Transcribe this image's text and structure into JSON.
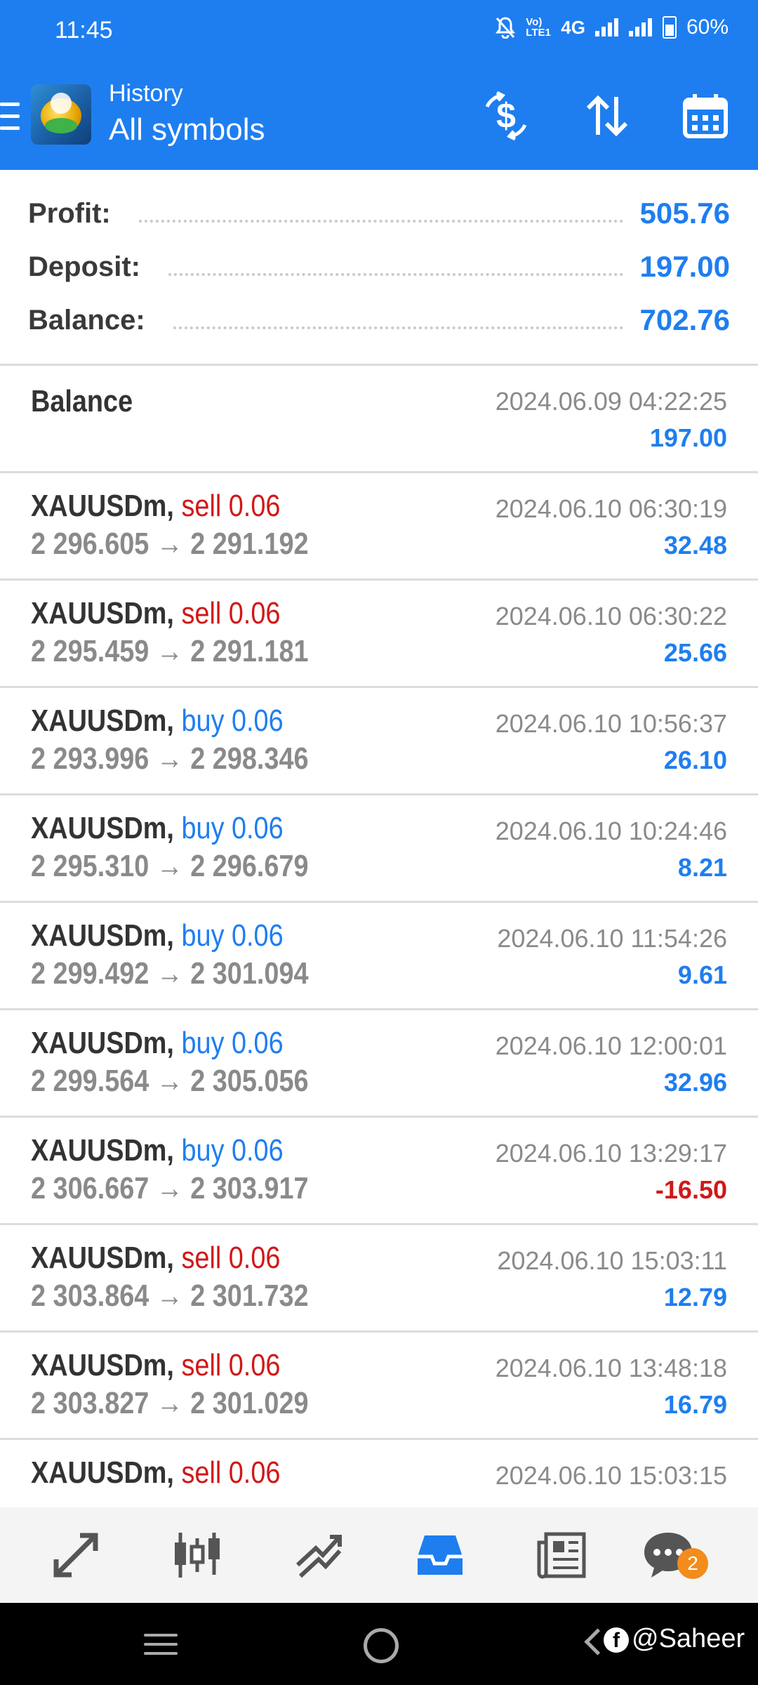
{
  "status_bar": {
    "time": "11:45",
    "network": "4G",
    "volte": "Vo) LTE1",
    "battery": "60%"
  },
  "header": {
    "subtitle": "History",
    "title": "All symbols"
  },
  "summary": {
    "profit_label": "Profit:",
    "profit_value": "505.76",
    "deposit_label": "Deposit:",
    "deposit_value": "197.00",
    "balance_label": "Balance:",
    "balance_value": "702.76"
  },
  "balance_entry": {
    "label": "Balance",
    "datetime": "2024.06.09 04:22:25",
    "amount": "197.00"
  },
  "trades": [
    {
      "symbol": "XAUUSDm,",
      "type": "sell 0.06",
      "side": "sell",
      "prices": "2 296.605 → 2 291.192",
      "datetime": "2024.06.10 06:30:19",
      "profit": "32.48"
    },
    {
      "symbol": "XAUUSDm,",
      "type": "sell 0.06",
      "side": "sell",
      "prices": "2 295.459 → 2 291.181",
      "datetime": "2024.06.10 06:30:22",
      "profit": "25.66"
    },
    {
      "symbol": "XAUUSDm,",
      "type": "buy 0.06",
      "side": "buy",
      "prices": "2 293.996 → 2 298.346",
      "datetime": "2024.06.10 10:56:37",
      "profit": "26.10"
    },
    {
      "symbol": "XAUUSDm,",
      "type": "buy 0.06",
      "side": "buy",
      "prices": "2 295.310 → 2 296.679",
      "datetime": "2024.06.10 10:24:46",
      "profit": "8.21"
    },
    {
      "symbol": "XAUUSDm,",
      "type": "buy 0.06",
      "side": "buy",
      "prices": "2 299.492 → 2 301.094",
      "datetime": "2024.06.10 11:54:26",
      "profit": "9.61"
    },
    {
      "symbol": "XAUUSDm,",
      "type": "buy 0.06",
      "side": "buy",
      "prices": "2 299.564 → 2 305.056",
      "datetime": "2024.06.10 12:00:01",
      "profit": "32.96"
    },
    {
      "symbol": "XAUUSDm,",
      "type": "buy 0.06",
      "side": "buy",
      "prices": "2 306.667 → 2 303.917",
      "datetime": "2024.06.10 13:29:17",
      "profit": "-16.50"
    },
    {
      "symbol": "XAUUSDm,",
      "type": "sell 0.06",
      "side": "sell",
      "prices": "2 303.864 → 2 301.732",
      "datetime": "2024.06.10 15:03:11",
      "profit": "12.79"
    },
    {
      "symbol": "XAUUSDm,",
      "type": "sell 0.06",
      "side": "sell",
      "prices": "2 303.827 → 2 301.029",
      "datetime": "2024.06.10 13:48:18",
      "profit": "16.79"
    },
    {
      "symbol": "XAUUSDm,",
      "type": "sell 0.06",
      "side": "sell",
      "prices": "",
      "datetime": "2024.06.10 15:03:15",
      "profit": ""
    }
  ],
  "bottom_nav": {
    "items": [
      "quotes-icon",
      "chart-icon",
      "trade-icon",
      "history-icon",
      "news-icon",
      "chat-icon"
    ],
    "active": "history-icon",
    "chat_badge": "2"
  },
  "watermark": "@Saheer",
  "colors": {
    "accent": "#1e7ef0",
    "sell": "#d01818",
    "buy": "#1e7ef0",
    "negative": "#d01818"
  }
}
